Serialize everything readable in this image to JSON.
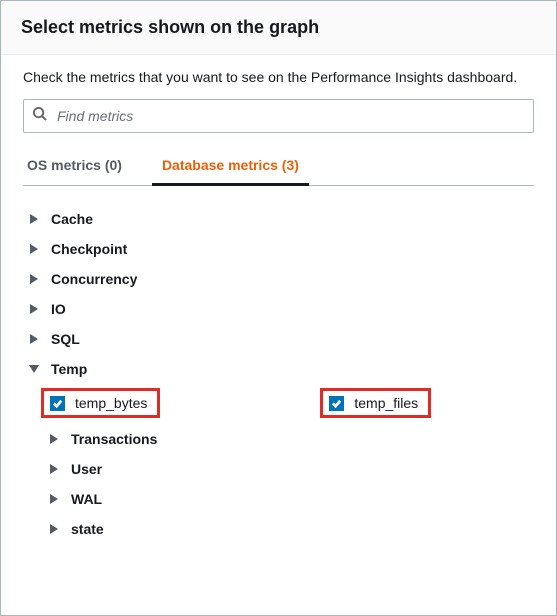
{
  "header": {
    "title": "Select metrics shown on the graph"
  },
  "description": "Check the metrics that you want to see on the Performance Insights dashboard.",
  "search": {
    "placeholder": "Find metrics"
  },
  "tabs": {
    "os": "OS metrics (0)",
    "db": "Database metrics (3)"
  },
  "tree": {
    "cache": "Cache",
    "checkpoint": "Checkpoint",
    "concurrency": "Concurrency",
    "io": "IO",
    "sql": "SQL",
    "temp": "Temp",
    "temp_bytes": "temp_bytes",
    "temp_files": "temp_files",
    "transactions": "Transactions",
    "user": "User",
    "wal": "WAL",
    "state": "state"
  }
}
